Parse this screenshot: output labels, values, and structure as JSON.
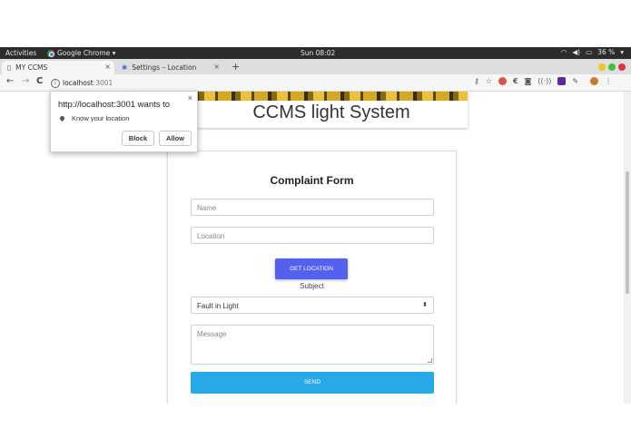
{
  "system_bar": {
    "activities": "Activities",
    "app_name": "Google Chrome ▾",
    "clock": "Sun 08:02",
    "battery": "36 %"
  },
  "tabs": [
    {
      "label": "MY CCMS",
      "close": "×"
    },
    {
      "label": "Settings – Location",
      "close": "×"
    }
  ],
  "new_tab": "+",
  "toolbar": {
    "back": "←",
    "forward": "→",
    "reload": "C",
    "info": "i",
    "url_host": "localhost",
    "url_port": ":3001",
    "more": "⋮"
  },
  "header": {
    "title": "CCMS light System"
  },
  "form": {
    "title": "Complaint Form",
    "name_placeholder": "Name",
    "location_placeholder": "Location",
    "get_location_label": "GET LOCATION",
    "subject_label": "Subject",
    "subject_selected": "Fault in Light",
    "message_placeholder": "Message",
    "send_label": "SEND"
  },
  "permission_popup": {
    "title": "http://localhost:3001 wants to",
    "permission": "Know your location",
    "block_label": "Block",
    "allow_label": "Allow",
    "close": "×"
  },
  "colors": {
    "get_location_button": "#5460f0",
    "send_button": "#27a9e8",
    "topbar": "#2c2c2c"
  }
}
